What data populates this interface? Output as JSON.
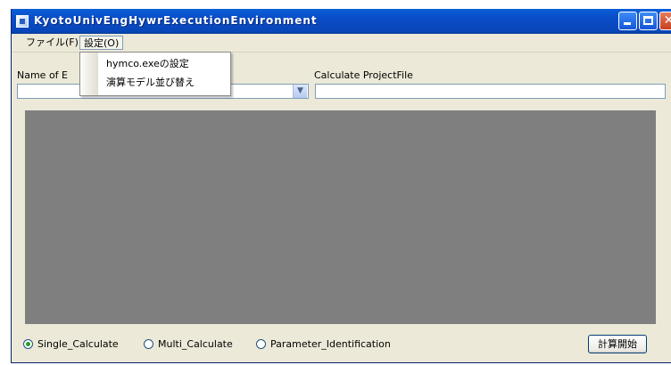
{
  "window": {
    "title": "KyotoUnivEngHywrExecutionEnvironment",
    "controls": {
      "minimize_icon": "minimize-icon",
      "maximize_icon": "maximize-icon",
      "close_symbol": "✕"
    }
  },
  "menubar": {
    "items": [
      {
        "label": "ファイル(F)"
      },
      {
        "label": "設定(O)"
      }
    ]
  },
  "settings_menu": {
    "items": [
      {
        "label": "hymco.exeの設定"
      },
      {
        "label": "演算モデル並び替え"
      }
    ]
  },
  "form": {
    "name_label": "Name of E",
    "combo_value": "",
    "combo_arrow": "chevron-down-icon",
    "project_file_label": "Calculate ProjectFile",
    "project_file_value": ""
  },
  "options": {
    "radios": [
      {
        "label": "Single_Calculate",
        "checked": true
      },
      {
        "label": "Multi_Calculate",
        "checked": false
      },
      {
        "label": "Parameter_Identification",
        "checked": false
      }
    ]
  },
  "actions": {
    "start_label": "計算開始"
  },
  "colors": {
    "titlebar": "#0a4cc6",
    "window_bg": "#ece9d8",
    "panel_bg": "#7f7f7f",
    "radio_checked": "#21a121",
    "close_button": "#c7401f"
  }
}
